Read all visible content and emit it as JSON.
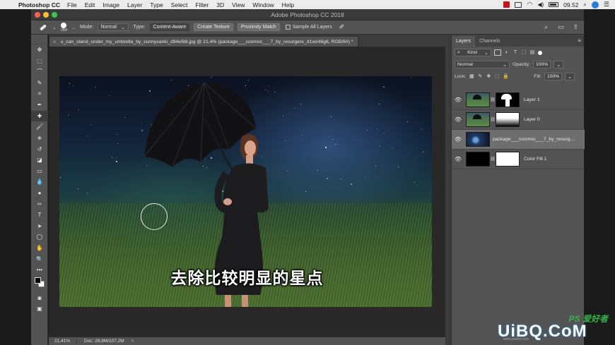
{
  "menubar": {
    "app_name": "Photoshop CC",
    "items": [
      "File",
      "Edit",
      "Image",
      "Layer",
      "Type",
      "Select",
      "Filter",
      "3D",
      "View",
      "Window",
      "Help"
    ],
    "clock": "09.52"
  },
  "window": {
    "title": "Adobe Photoshop CC 2018"
  },
  "options_bar": {
    "brush_size": "284",
    "mode_label": "Mode:",
    "mode_value": "Normal",
    "type_label": "Type:",
    "type_buttons": [
      "Content-Aware",
      "Create Texture",
      "Proximity Match"
    ],
    "sample_all_layers": "Sample All Layers"
  },
  "tools": {
    "items": [
      "move-tool",
      "marquee-tool",
      "lasso-tool",
      "quick-select-tool",
      "crop-tool",
      "eyedropper-tool",
      "spot-healing-brush-tool",
      "brush-tool",
      "clone-stamp-tool",
      "history-brush-tool",
      "eraser-tool",
      "gradient-tool",
      "blur-tool",
      "dodge-tool",
      "pen-tool",
      "type-tool",
      "path-select-tool",
      "ellipse-tool",
      "hand-tool",
      "zoom-tool",
      "more-tools"
    ],
    "glyphs": [
      "✥",
      "⬚",
      "⌒",
      "✎",
      "⌗",
      "✒",
      "✚",
      "🖌",
      "⎈",
      "↺",
      "◪",
      "▭",
      "💧",
      "●",
      "✑",
      "T",
      "➤",
      "◯",
      "✋",
      "🔍",
      "•••"
    ],
    "active_index": 6
  },
  "document": {
    "tab_title": "u_can_stand_under_my_umbrella_by_sunnysanki_d94e5t8.jpg @ 21,4% (package___cosmos___7_by_resurgere_d1wz48g6, RGB/8#) *",
    "caption": "去除比较明显的星点"
  },
  "statusbar": {
    "zoom": "21,41%",
    "doc": "Doc: 28,8M/107,2M",
    "arrow": ">"
  },
  "layers_panel": {
    "tabs": [
      "Layers",
      "Channels"
    ],
    "filter_kind": "Kind",
    "blend_mode": "Normal",
    "opacity_label": "Opacity:",
    "opacity_value": "100%",
    "lock_label": "Lock:",
    "fill_label": "Fill:",
    "fill_value": "100%",
    "layers": [
      {
        "name": "Layer 1",
        "thumb": "photo",
        "mask": "shape",
        "selected": false
      },
      {
        "name": "Layer 0",
        "thumb": "photo",
        "mask": "gradient",
        "selected": false
      },
      {
        "name": "package___cosmos___7_by_resurgere...",
        "thumb": "cosmos",
        "mask": null,
        "selected": true
      },
      {
        "name": "Color Fill 1",
        "thumb": "black",
        "mask": "white",
        "selected": false
      }
    ]
  },
  "watermark": {
    "ps": "PS 爱好者",
    "main": "UiBQ.CoM",
    "sub": "www.psahz.com"
  }
}
